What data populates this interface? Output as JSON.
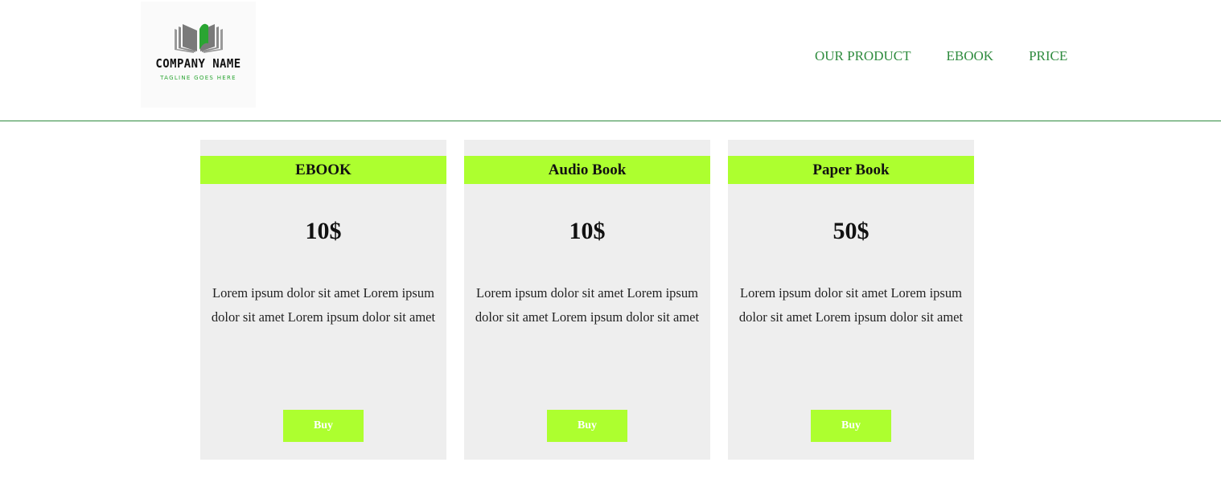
{
  "brand": {
    "name": "COMPANY NAME",
    "tagline": "TAGLINE GOES HERE",
    "logo_icon": "open-book-icon",
    "accent_green": "#2e8b3e",
    "logo_green": "#2aa532"
  },
  "nav": {
    "items": [
      {
        "label": "OUR PRODUCT"
      },
      {
        "label": "EBOOK"
      },
      {
        "label": "PRICE"
      }
    ]
  },
  "theme": {
    "card_bg": "#eeeeee",
    "highlight": "#adff2f"
  },
  "cards": [
    {
      "title": "EBOOK",
      "price": "10$",
      "description": "Lorem ipsum dolor sit amet Lorem ipsum dolor sit amet Lorem ipsum dolor sit amet",
      "button": "Buy"
    },
    {
      "title": "Audio Book",
      "price": "10$",
      "description": "Lorem ipsum dolor sit amet Lorem ipsum dolor sit amet Lorem ipsum dolor sit amet",
      "button": "Buy"
    },
    {
      "title": "Paper Book",
      "price": "50$",
      "description": "Lorem ipsum dolor sit amet Lorem ipsum dolor sit amet Lorem ipsum dolor sit amet",
      "button": "Buy"
    }
  ]
}
